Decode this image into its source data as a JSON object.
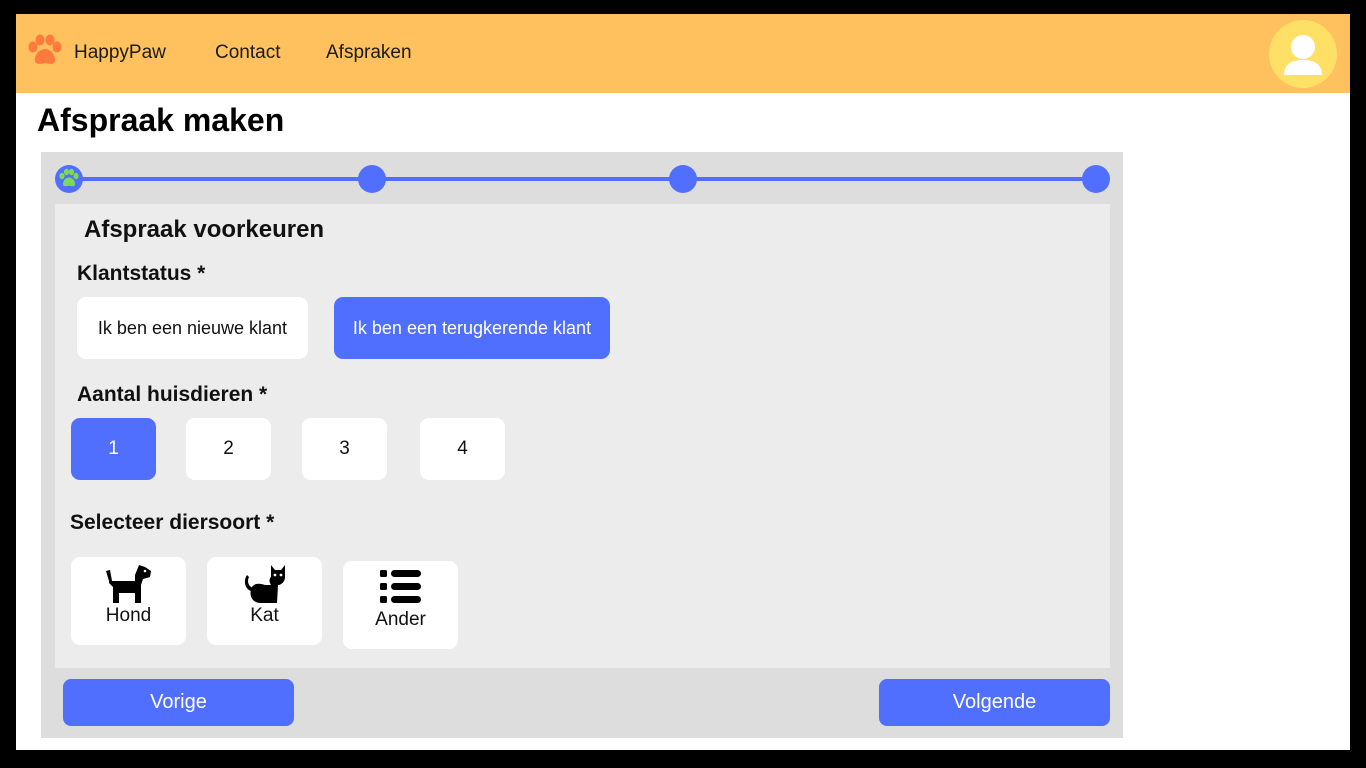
{
  "header": {
    "brand": "HappyPaw",
    "nav": [
      "Contact",
      "Afspraken"
    ],
    "brand_color": "#ffc05e",
    "logo_icon": "paw-icon",
    "avatar_icon": "user-icon"
  },
  "page": {
    "title": "Afspraak maken"
  },
  "wizard": {
    "steps_total": 4,
    "current_step": 1,
    "accent_color": "#516fff",
    "panel_title": "Afspraak voorkeuren",
    "klantstatus": {
      "label": "Klantstatus *",
      "options": [
        "Ik ben een nieuwe klant",
        "Ik ben een terugkerende klant"
      ],
      "selected": "Ik ben een terugkerende klant"
    },
    "huisdieren": {
      "label": "Aantal huisdieren *",
      "options": [
        "1",
        "2",
        "3",
        "4"
      ],
      "selected": "1"
    },
    "diersoort": {
      "label": "Selecteer diersoort *",
      "options": [
        {
          "label": "Hond",
          "icon": "dog-icon"
        },
        {
          "label": "Kat",
          "icon": "cat-icon"
        },
        {
          "label": "Ander",
          "icon": "list-icon"
        }
      ]
    },
    "prev_label": "Vorige",
    "next_label": "Volgende"
  }
}
